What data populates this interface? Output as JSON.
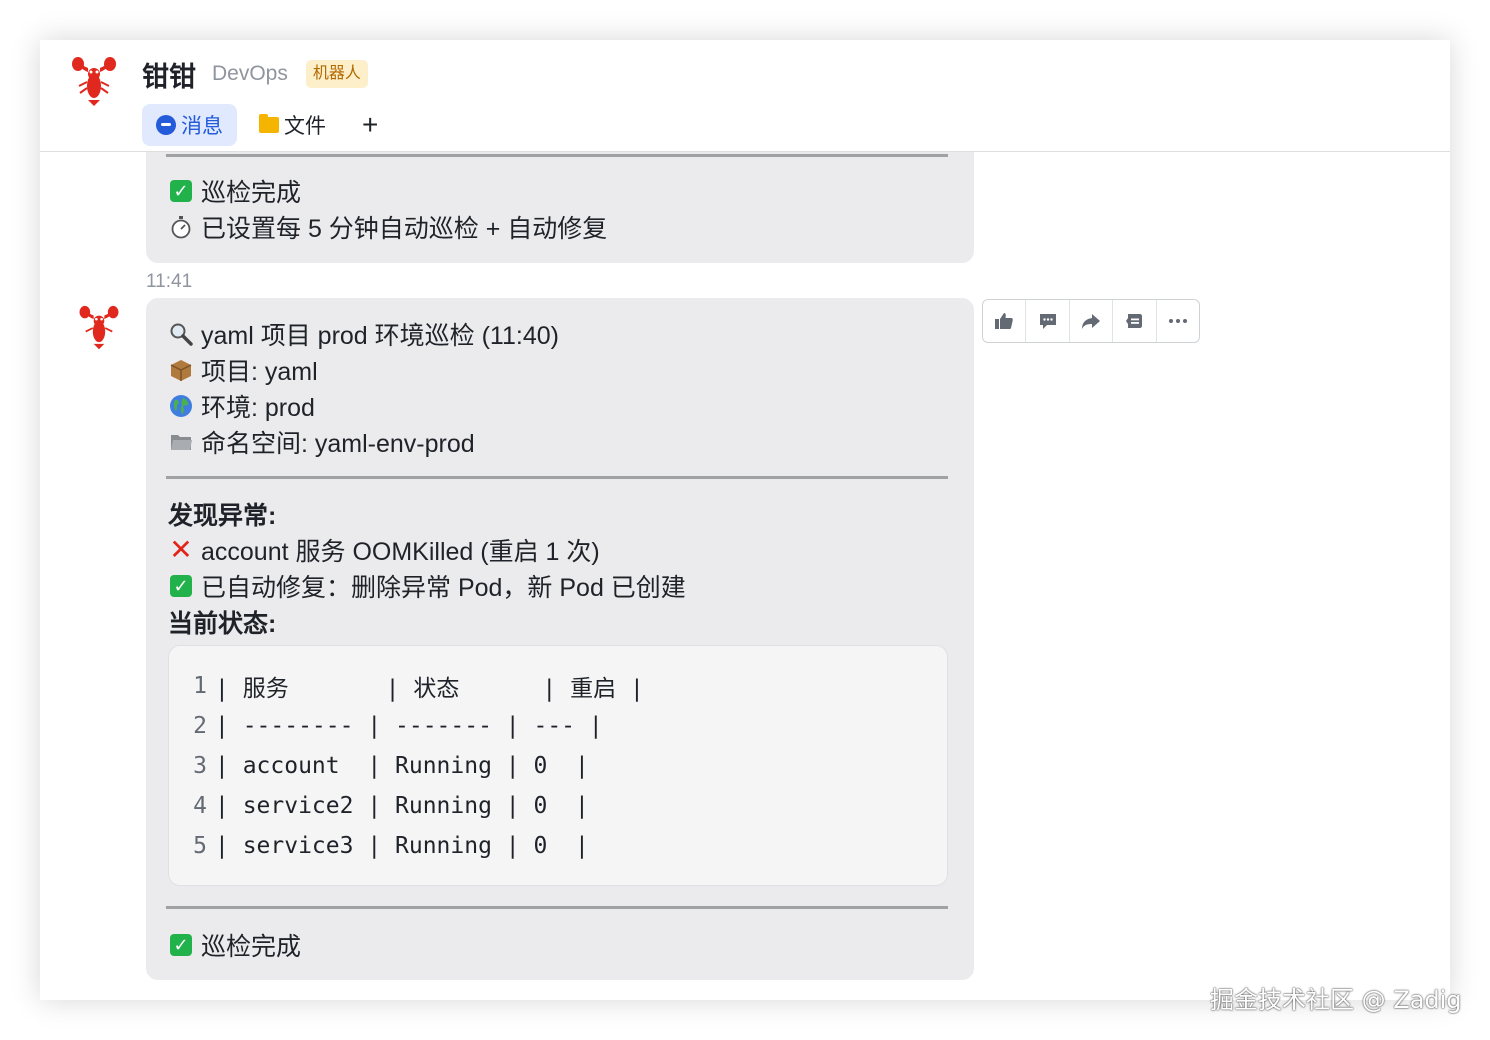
{
  "header": {
    "bot_name": "钳钳",
    "bot_org": "DevOps",
    "bot_badge": "机器人",
    "tabs": [
      {
        "label": "消息",
        "icon": "message-icon",
        "active": true
      },
      {
        "label": "文件",
        "icon": "folder-icon",
        "active": false
      }
    ],
    "add_tab": "+"
  },
  "messages": [
    {
      "lines": [
        {
          "icon": "check-mark-icon",
          "text": "巡检完成"
        },
        {
          "icon": "stopwatch-icon",
          "text": "已设置每 5 分钟自动巡检 + 自动修复"
        }
      ]
    },
    {
      "time": "11:41",
      "intro": [
        {
          "icon": "magnifier-icon",
          "text": "yaml 项目 prod 环境巡检 (11:40)"
        },
        {
          "icon": "package-icon",
          "text": "项目: yaml"
        },
        {
          "icon": "globe-icon",
          "text": "环境: prod"
        },
        {
          "icon": "folder-icon",
          "text": "命名空间: yaml-env-prod"
        }
      ],
      "anomaly_title": "发现异常:",
      "anomalies": [
        {
          "icon": "cross-mark-icon",
          "text": "account 服务 OOMKilled (重启 1 次)"
        },
        {
          "icon": "check-mark-icon",
          "text": "已自动修复：删除异常 Pod，新 Pod 已创建"
        }
      ],
      "status_title": "当前状态:",
      "code_lines": [
        {
          "num": "1",
          "text": "| 服务       | 状态      | 重启 |"
        },
        {
          "num": "2",
          "text": "| -------- | ------- | --- |"
        },
        {
          "num": "3",
          "text": "| account  | Running | 0  |"
        },
        {
          "num": "4",
          "text": "| service2 | Running | 0  |"
        },
        {
          "num": "5",
          "text": "| service3 | Running | 0  |"
        }
      ],
      "footer": {
        "icon": "check-mark-icon",
        "text": "巡检完成"
      }
    }
  ],
  "toolbar": [
    "thumbs-up-icon",
    "comment-icon",
    "forward-icon",
    "quote-icon",
    "more-icon"
  ],
  "watermark": "掘金技术社区 @ Zadig"
}
